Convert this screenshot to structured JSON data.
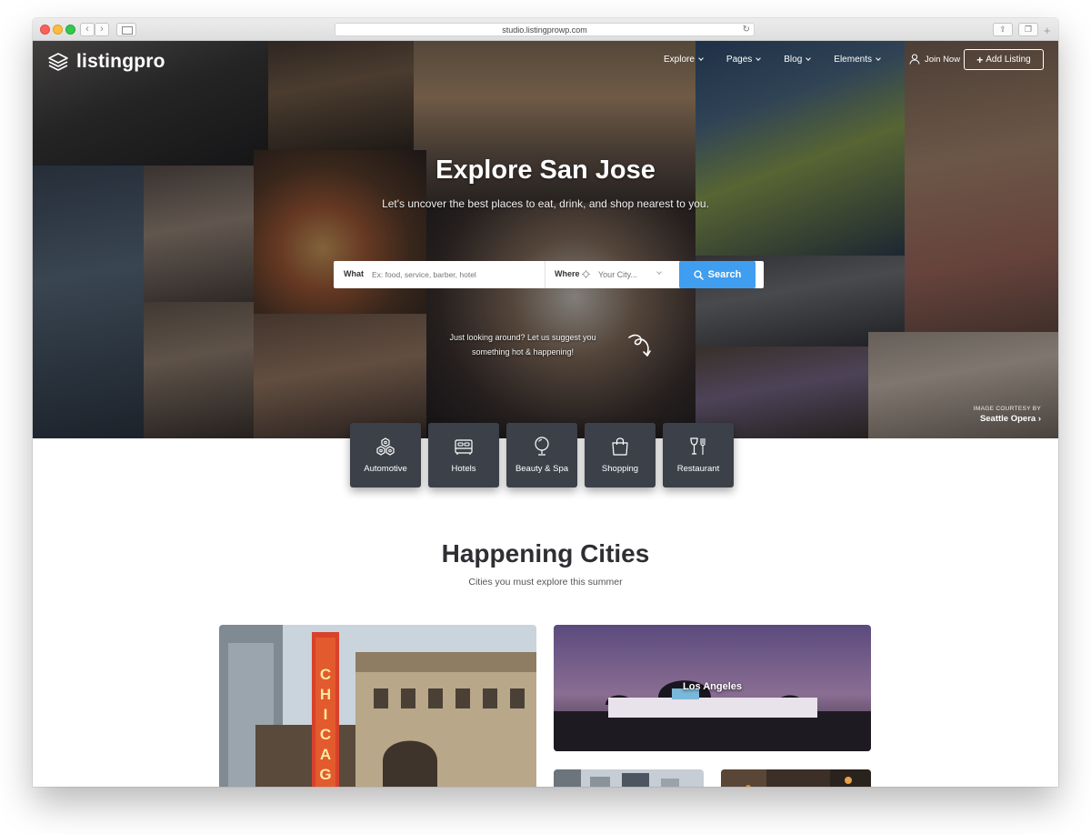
{
  "browser": {
    "url": "studio.listingprowp.com"
  },
  "header": {
    "logo_text": "listingpro",
    "nav": [
      {
        "label": "Explore"
      },
      {
        "label": "Pages"
      },
      {
        "label": "Blog"
      },
      {
        "label": "Elements"
      }
    ],
    "join_label": "Join Now",
    "add_listing_label": "Add Listing"
  },
  "hero": {
    "title": "Explore San Jose",
    "subtitle": "Let's uncover the best places to eat, drink, and shop nearest to you.",
    "search": {
      "what_label": "What",
      "what_placeholder": "Ex: food, service, barber, hotel",
      "where_label": "Where",
      "where_placeholder": "Your City...",
      "button_label": "Search"
    },
    "suggest_line1": "Just looking around? Let us suggest you",
    "suggest_line2": "something hot & happening!",
    "courtesy_label": "IMAGE COURTESY BY",
    "courtesy_name": "Seattle Opera"
  },
  "categories": [
    {
      "label": "Automotive",
      "icon": "automotive-icon"
    },
    {
      "label": "Hotels",
      "icon": "bed-icon"
    },
    {
      "label": "Beauty & Spa",
      "icon": "mirror-icon"
    },
    {
      "label": "Shopping",
      "icon": "shopping-bag-icon"
    },
    {
      "label": "Restaurant",
      "icon": "restaurant-icon"
    }
  ],
  "cities_section": {
    "title": "Happening Cities",
    "subtitle": "Cities you must explore this summer",
    "cities": [
      {
        "name": "Los Angeles"
      }
    ]
  },
  "colors": {
    "accent": "#3f9ef0",
    "category_tile": "#3c4049",
    "heading": "#2e2f33"
  }
}
